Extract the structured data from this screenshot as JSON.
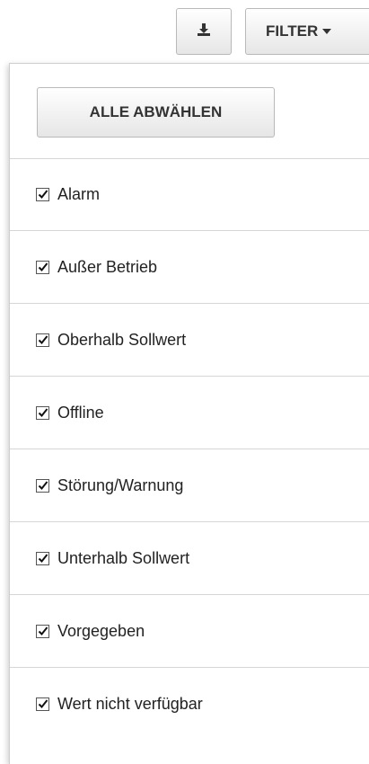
{
  "toolbar": {
    "download_icon": "download-icon",
    "filter_label": "FILTER"
  },
  "dropdown": {
    "deselect_label": "ALLE ABWÄHLEN",
    "options": [
      {
        "label": "Alarm",
        "checked": true
      },
      {
        "label": "Außer Betrieb",
        "checked": true
      },
      {
        "label": "Oberhalb Sollwert",
        "checked": true
      },
      {
        "label": "Offline",
        "checked": true
      },
      {
        "label": "Störung/Warnung",
        "checked": true
      },
      {
        "label": "Unterhalb Sollwert",
        "checked": true
      },
      {
        "label": "Vorgegeben",
        "checked": true
      },
      {
        "label": "Wert nicht verfügbar",
        "checked": true
      }
    ]
  }
}
